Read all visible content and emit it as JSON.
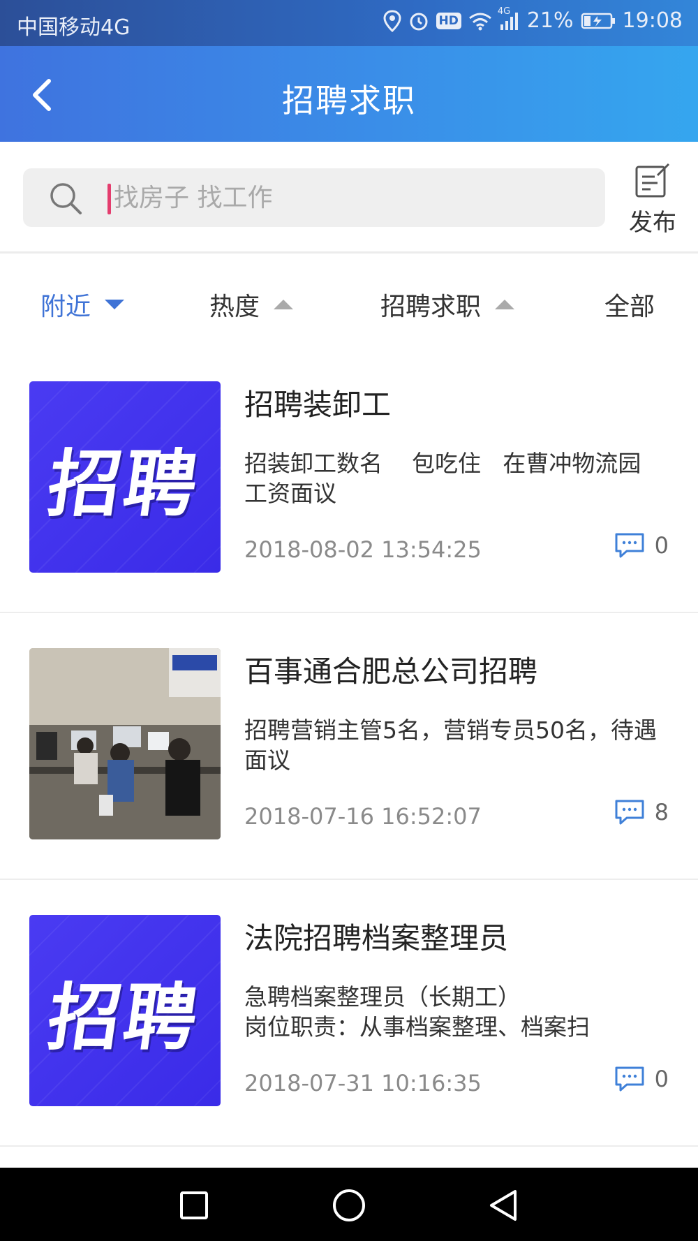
{
  "status_bar": {
    "carrier": "中国移动4G",
    "hd": "HD",
    "network": "4G",
    "battery": "21%",
    "time": "19:08"
  },
  "header": {
    "title": "招聘求职",
    "back_icon": "chevron-left-icon"
  },
  "search": {
    "placeholder": "找房子 找工作",
    "value": "",
    "icon": "search-icon"
  },
  "publish": {
    "label": "发布",
    "icon": "edit-icon"
  },
  "filters": [
    {
      "label": "附近",
      "arrow": "down",
      "active": true
    },
    {
      "label": "热度",
      "arrow": "up",
      "active": false
    },
    {
      "label": "招聘求职",
      "arrow": "up",
      "active": false
    },
    {
      "label": "全部",
      "arrow": "none",
      "active": false
    }
  ],
  "listings": [
    {
      "thumb_text": "招聘",
      "title": "招聘装卸工",
      "desc": "招装卸工数名    包吃住   在曹冲物流园     工资面议",
      "time": "2018-08-02 13:54:25",
      "comments": "0"
    },
    {
      "thumb_text": "",
      "title": "百事通合肥总公司招聘",
      "desc": "招聘营销主管5名，营销专员50名，待遇面议",
      "time": "2018-07-16 16:52:07",
      "comments": "8"
    },
    {
      "thumb_text": "招聘",
      "title": "法院招聘档案整理员",
      "desc": "急聘档案整理员（长期工）\n岗位职责：从事档案整理、档案扫",
      "time": "2018-07-31 10:16:35",
      "comments": "0"
    }
  ],
  "colors": {
    "accent": "#3f73d6",
    "header_gradient_start": "#3f73df",
    "header_gradient_end": "#35a6ef",
    "thumb_blue": "#4a3bf2"
  }
}
